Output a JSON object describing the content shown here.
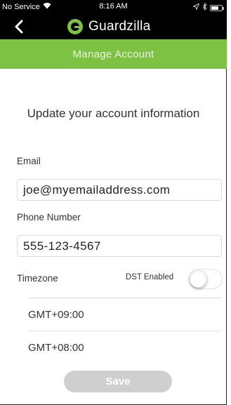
{
  "status_bar": {
    "carrier": "No Service",
    "time": "8:16 AM",
    "icons": [
      "wifi-icon",
      "location-icon",
      "bluetooth-icon",
      "battery-icon"
    ]
  },
  "header": {
    "brand": "Guardzilla",
    "back_icon": "chevron-left-icon",
    "brand_color": "#7dc242"
  },
  "title_bar": {
    "title": "Manage Account"
  },
  "form": {
    "heading": "Update your account information",
    "email_label": "Email",
    "email_value": "joe@myemailaddress.com",
    "phone_label": "Phone Number",
    "phone_value": "555-123-4567",
    "timezone_label": "Timezone",
    "dst_label": "DST Enabled",
    "dst_enabled": false,
    "timezones": [
      "GMT+09:00",
      "GMT+08:00"
    ],
    "save_label": "Save"
  }
}
